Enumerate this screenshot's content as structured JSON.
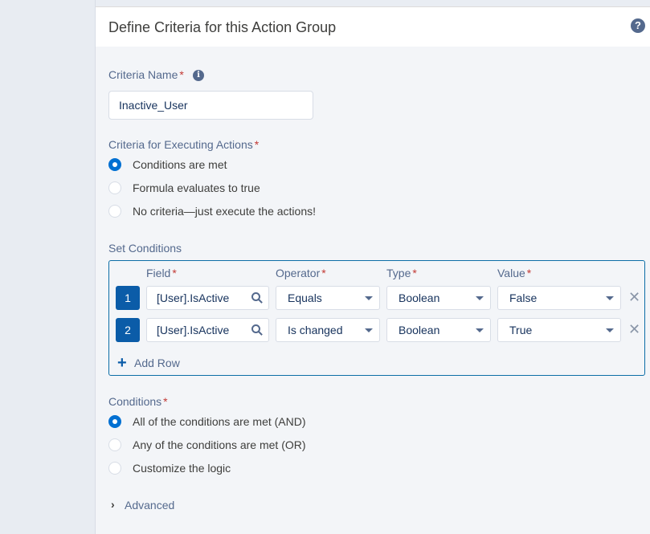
{
  "header": {
    "title": "Define Criteria for this Action Group",
    "help_glyph": "?"
  },
  "criteria_name": {
    "label": "Criteria Name",
    "required": "*",
    "value": "Inactive_User",
    "info_glyph": "i"
  },
  "execution": {
    "label": "Criteria for Executing Actions",
    "required": "*",
    "options": [
      {
        "label": "Conditions are met",
        "selected": true
      },
      {
        "label": "Formula evaluates to true",
        "selected": false
      },
      {
        "label": "No criteria—just execute the actions!",
        "selected": false
      }
    ]
  },
  "set_conditions": {
    "label": "Set Conditions",
    "columns": {
      "field": "Field",
      "operator": "Operator",
      "type": "Type",
      "value": "Value",
      "required": "*"
    },
    "rows": [
      {
        "num": "1",
        "field": "[User].IsActive",
        "operator": "Equals",
        "type": "Boolean",
        "value": "False"
      },
      {
        "num": "2",
        "field": "[User].IsActive",
        "operator": "Is changed",
        "type": "Boolean",
        "value": "True"
      }
    ],
    "add_row_label": "Add Row",
    "remove_glyph": "✕"
  },
  "conditions": {
    "label": "Conditions",
    "required": "*",
    "options": [
      {
        "label": "All of the conditions are met (AND)",
        "selected": true
      },
      {
        "label": "Any of the conditions are met (OR)",
        "selected": false
      },
      {
        "label": "Customize the logic",
        "selected": false
      }
    ]
  },
  "advanced": {
    "label": "Advanced"
  },
  "colors": {
    "accent": "#0070d2",
    "row_badge": "#0b5ca8",
    "label": "#54698d",
    "required": "#c23934"
  }
}
